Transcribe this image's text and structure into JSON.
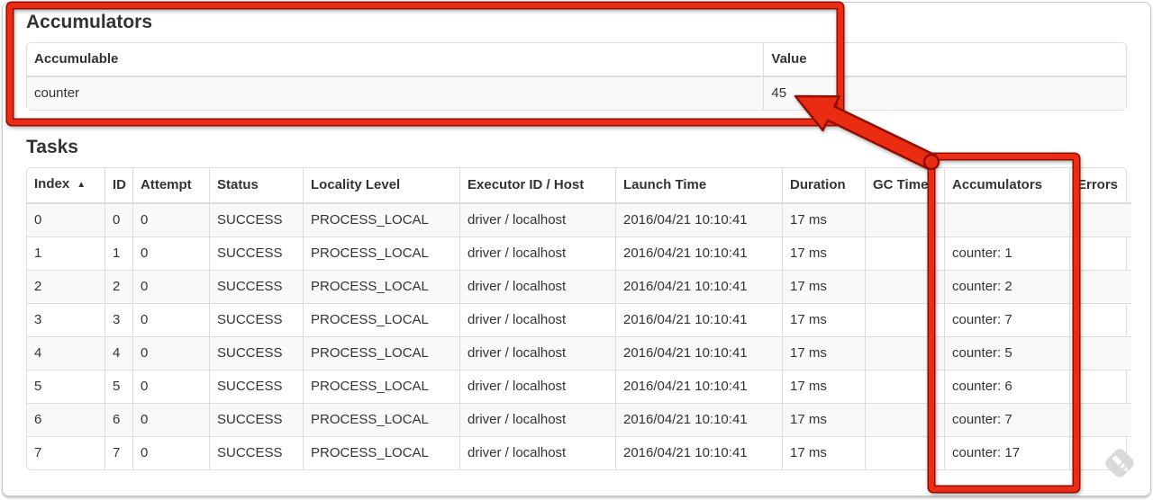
{
  "accumulators_section": {
    "title": "Accumulators",
    "table": {
      "col_accumulable": "Accumulable",
      "col_value": "Value",
      "rows": [
        {
          "accumulable": "counter",
          "value": "45"
        }
      ]
    }
  },
  "tasks_section": {
    "title": "Tasks",
    "table": {
      "headers": [
        {
          "key": "index",
          "label": "Index",
          "sort": "▲"
        },
        {
          "key": "id",
          "label": "ID"
        },
        {
          "key": "attempt",
          "label": "Attempt"
        },
        {
          "key": "status",
          "label": "Status"
        },
        {
          "key": "locality",
          "label": "Locality Level"
        },
        {
          "key": "executor",
          "label": "Executor ID / Host"
        },
        {
          "key": "launch_time",
          "label": "Launch Time"
        },
        {
          "key": "duration",
          "label": "Duration"
        },
        {
          "key": "gc_time",
          "label": "GC Time"
        },
        {
          "key": "accumulators",
          "label": "Accumulators"
        },
        {
          "key": "errors",
          "label": "Errors"
        }
      ],
      "rows": [
        {
          "index": "0",
          "id": "0",
          "attempt": "0",
          "status": "SUCCESS",
          "locality": "PROCESS_LOCAL",
          "executor": "driver / localhost",
          "launch_time": "2016/04/21 10:10:41",
          "duration": "17 ms",
          "gc_time": "",
          "accumulators": "",
          "errors": ""
        },
        {
          "index": "1",
          "id": "1",
          "attempt": "0",
          "status": "SUCCESS",
          "locality": "PROCESS_LOCAL",
          "executor": "driver / localhost",
          "launch_time": "2016/04/21 10:10:41",
          "duration": "17 ms",
          "gc_time": "",
          "accumulators": "counter: 1",
          "errors": ""
        },
        {
          "index": "2",
          "id": "2",
          "attempt": "0",
          "status": "SUCCESS",
          "locality": "PROCESS_LOCAL",
          "executor": "driver / localhost",
          "launch_time": "2016/04/21 10:10:41",
          "duration": "17 ms",
          "gc_time": "",
          "accumulators": "counter: 2",
          "errors": ""
        },
        {
          "index": "3",
          "id": "3",
          "attempt": "0",
          "status": "SUCCESS",
          "locality": "PROCESS_LOCAL",
          "executor": "driver / localhost",
          "launch_time": "2016/04/21 10:10:41",
          "duration": "17 ms",
          "gc_time": "",
          "accumulators": "counter: 7",
          "errors": ""
        },
        {
          "index": "4",
          "id": "4",
          "attempt": "0",
          "status": "SUCCESS",
          "locality": "PROCESS_LOCAL",
          "executor": "driver / localhost",
          "launch_time": "2016/04/21 10:10:41",
          "duration": "17 ms",
          "gc_time": "",
          "accumulators": "counter: 5",
          "errors": ""
        },
        {
          "index": "5",
          "id": "5",
          "attempt": "0",
          "status": "SUCCESS",
          "locality": "PROCESS_LOCAL",
          "executor": "driver / localhost",
          "launch_time": "2016/04/21 10:10:41",
          "duration": "17 ms",
          "gc_time": "",
          "accumulators": "counter: 6",
          "errors": ""
        },
        {
          "index": "6",
          "id": "6",
          "attempt": "0",
          "status": "SUCCESS",
          "locality": "PROCESS_LOCAL",
          "executor": "driver / localhost",
          "launch_time": "2016/04/21 10:10:41",
          "duration": "17 ms",
          "gc_time": "",
          "accumulators": "counter: 7",
          "errors": ""
        },
        {
          "index": "7",
          "id": "7",
          "attempt": "0",
          "status": "SUCCESS",
          "locality": "PROCESS_LOCAL",
          "executor": "driver / localhost",
          "launch_time": "2016/04/21 10:10:41",
          "duration": "17 ms",
          "gc_time": "",
          "accumulators": "counter: 17",
          "errors": ""
        }
      ]
    }
  },
  "annotations": {
    "highlight_fill": "#ec2c12",
    "highlight_edge": "#8f1003"
  },
  "watermark": {
    "icon_color": "#d8d8d8"
  }
}
